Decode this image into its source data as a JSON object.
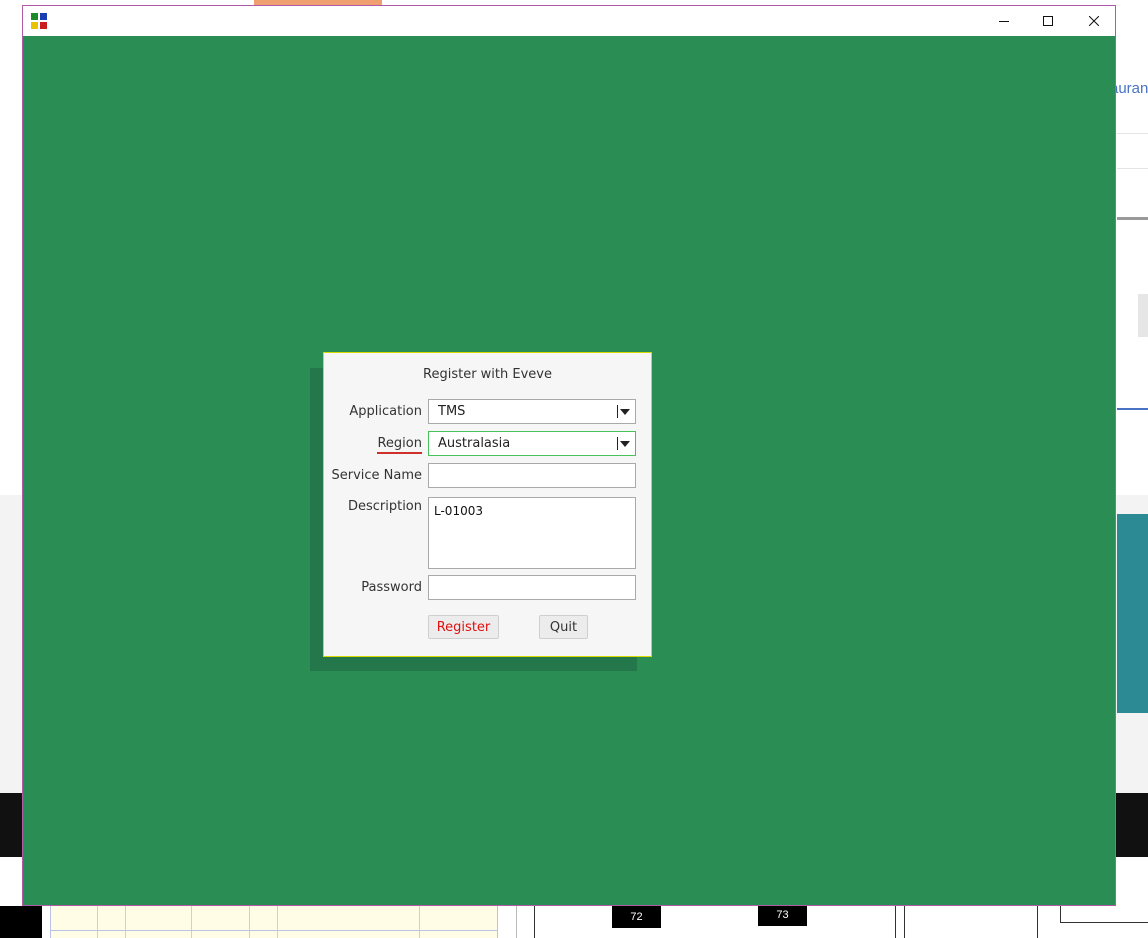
{
  "background": {
    "partial_link_text": "auran",
    "page_numbers": [
      "72",
      "73"
    ]
  },
  "window": {
    "icon": "app-grid-icon",
    "controls": {
      "minimize_icon": "minimize-icon",
      "maximize_icon": "maximize-icon",
      "close_icon": "close-icon"
    },
    "background_color": "#2a8d53"
  },
  "dialog": {
    "title": "Register with Eveve",
    "application": {
      "label": "Application",
      "value": "TMS"
    },
    "region": {
      "label": "Region",
      "value": "Australasia"
    },
    "service_name": {
      "label": "Service Name",
      "value": ""
    },
    "description": {
      "label": "Description",
      "value": "L-01003"
    },
    "password": {
      "label": "Password",
      "value": ""
    },
    "register_label": "Register",
    "quit_label": "Quit"
  },
  "colors": {
    "register_text": "#e01010",
    "required_underline": "#d0302a",
    "focus_border": "#47c25a"
  }
}
